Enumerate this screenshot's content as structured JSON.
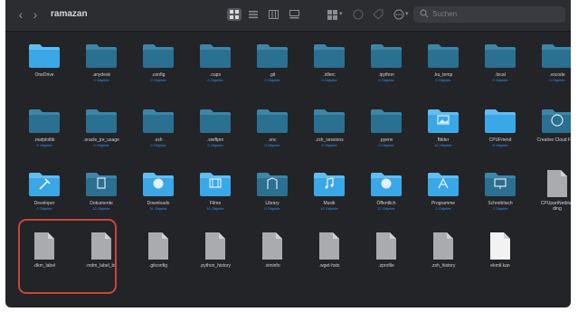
{
  "window": {
    "title": "ramazan"
  },
  "toolbar": {
    "search_placeholder": "Suchen",
    "nav_back_icon": "chevron-left-icon",
    "nav_forward_icon": "chevron-right-icon",
    "view_modes": [
      "icon-view-icon",
      "list-view-icon",
      "column-view-icon",
      "gallery-view-icon"
    ],
    "active_view": "icon-view-icon",
    "actions": [
      "group-by-icon",
      "share-icon",
      "tag-icon",
      "more-actions-icon"
    ]
  },
  "colors": {
    "window_bg": "#222428",
    "toolbar_bg": "#2c2d31",
    "folder_dark": "#2b6f91",
    "folder_light": "#3aa7e6",
    "file_gray": "#a9abaf",
    "file_white": "#f2f2f2",
    "subtitle_blue": "#3e8fe6",
    "highlight_red": "#c8463c"
  },
  "items": [
    {
      "name": "OneDrive",
      "sub": "",
      "type": "folder",
      "variant": "light",
      "emblem": ""
    },
    {
      "name": ".anydesk",
      "sub": "0 Objekte",
      "type": "folder",
      "variant": "dark",
      "emblem": ""
    },
    {
      "name": ".config",
      "sub": "0 Objekte",
      "type": "folder",
      "variant": "dark",
      "emblem": ""
    },
    {
      "name": ".cups",
      "sub": "0 Objekte",
      "type": "folder",
      "variant": "dark",
      "emblem": ""
    },
    {
      "name": ".git",
      "sub": "0 Objekte",
      "type": "folder",
      "variant": "dark",
      "emblem": ""
    },
    {
      "name": ".idlerc",
      "sub": "0 Objekte",
      "type": "folder",
      "variant": "dark",
      "emblem": ""
    },
    {
      "name": ".ipython",
      "sub": "0 Objekte",
      "type": "folder",
      "variant": "dark",
      "emblem": ""
    },
    {
      "name": ".ku_temp",
      "sub": "0 Objekte",
      "type": "folder",
      "variant": "dark",
      "emblem": ""
    },
    {
      "name": ".local",
      "sub": "0 Objekte",
      "type": "folder",
      "variant": "dark",
      "emblem": ""
    },
    {
      "name": ".vscode",
      "sub": "0 Objekte",
      "type": "folder",
      "variant": "dark",
      "emblem": ""
    },
    {
      "name": ".matplotlib",
      "sub": "0 Objekte",
      "type": "folder",
      "variant": "dark",
      "emblem": ""
    },
    {
      "name": ".oracle_jre_usage",
      "sub": "0 Objekte",
      "type": "folder",
      "variant": "dark",
      "emblem": ""
    },
    {
      "name": ".ssh",
      "sub": "0 Objekte",
      "type": "folder",
      "variant": "dark",
      "emblem": ""
    },
    {
      "name": ".swiftpm",
      "sub": "0 Objekte",
      "type": "folder",
      "variant": "dark",
      "emblem": ""
    },
    {
      "name": ".vnc",
      "sub": "0 Objekte",
      "type": "folder",
      "variant": "dark",
      "emblem": ""
    },
    {
      "name": ".zsh_sessions",
      "sub": "0 Objekte",
      "type": "folder",
      "variant": "dark",
      "emblem": ""
    },
    {
      "name": ".pyenv",
      "sub": "0 Objekte",
      "type": "folder",
      "variant": "dark",
      "emblem": ""
    },
    {
      "name": "Bilder",
      "sub": "42 Objekte",
      "type": "folder",
      "variant": "light",
      "emblem": "image"
    },
    {
      "name": "CPUFriend",
      "sub": "6 Objekte",
      "type": "folder",
      "variant": "light",
      "emblem": ""
    },
    {
      "name": "Creative Cloud Files",
      "sub": "",
      "type": "folder",
      "variant": "dark",
      "emblem": "cloud"
    },
    {
      "name": "Developer",
      "sub": "0 Objekte",
      "type": "folder",
      "variant": "light",
      "emblem": "hammer"
    },
    {
      "name": "Dokumente",
      "sub": "12 Objekte",
      "type": "folder",
      "variant": "dark",
      "emblem": "doc"
    },
    {
      "name": "Downloads",
      "sub": "31 Objekte",
      "type": "folder",
      "variant": "light",
      "emblem": "download"
    },
    {
      "name": "Filme",
      "sub": "10 Objekte",
      "type": "folder",
      "variant": "light",
      "emblem": "film"
    },
    {
      "name": "Library",
      "sub": "0 Objekte",
      "type": "folder",
      "variant": "dark",
      "emblem": "library"
    },
    {
      "name": "Musik",
      "sub": "12 Objekte",
      "type": "folder",
      "variant": "light",
      "emblem": "music"
    },
    {
      "name": "Öffentlich",
      "sub": "12 Objekte",
      "type": "folder",
      "variant": "light",
      "emblem": "public"
    },
    {
      "name": "Programme",
      "sub": "2 Objekte",
      "type": "folder",
      "variant": "light",
      "emblem": "apps"
    },
    {
      "name": "Schreibtisch",
      "sub": "2 Objekte",
      "type": "folder",
      "variant": "dark",
      "emblem": "desktop"
    },
    {
      "name": "CPUpartNetblue",
      "name2": "ding",
      "sub": "",
      "type": "file",
      "variant": "gray",
      "emblem": ""
    },
    {
      "name": ".dkm_label",
      "sub": "",
      "type": "file",
      "variant": "gray",
      "emblem": ""
    },
    {
      "name": ".mdm_label_bu",
      "sub": "",
      "type": "file",
      "variant": "gray",
      "emblem": ""
    },
    {
      "name": ".gitconfig",
      "sub": "",
      "type": "file",
      "variant": "gray",
      "emblem": ""
    },
    {
      "name": ".python_history",
      "sub": "",
      "type": "file",
      "variant": "gray",
      "emblem": ""
    },
    {
      "name": ".viminfo",
      "sub": "",
      "type": "file",
      "variant": "gray",
      "emblem": ""
    },
    {
      "name": ".wget-hsts",
      "sub": "",
      "type": "file",
      "variant": "gray",
      "emblem": ""
    },
    {
      "name": ".zprofile",
      "sub": "",
      "type": "file",
      "variant": "gray",
      "emblem": ""
    },
    {
      "name": ".zsh_history",
      "sub": "",
      "type": "file",
      "variant": "gray",
      "emblem": ""
    },
    {
      "name": "ekmtl.kan",
      "sub": "",
      "type": "file",
      "variant": "white",
      "emblem": ""
    }
  ]
}
